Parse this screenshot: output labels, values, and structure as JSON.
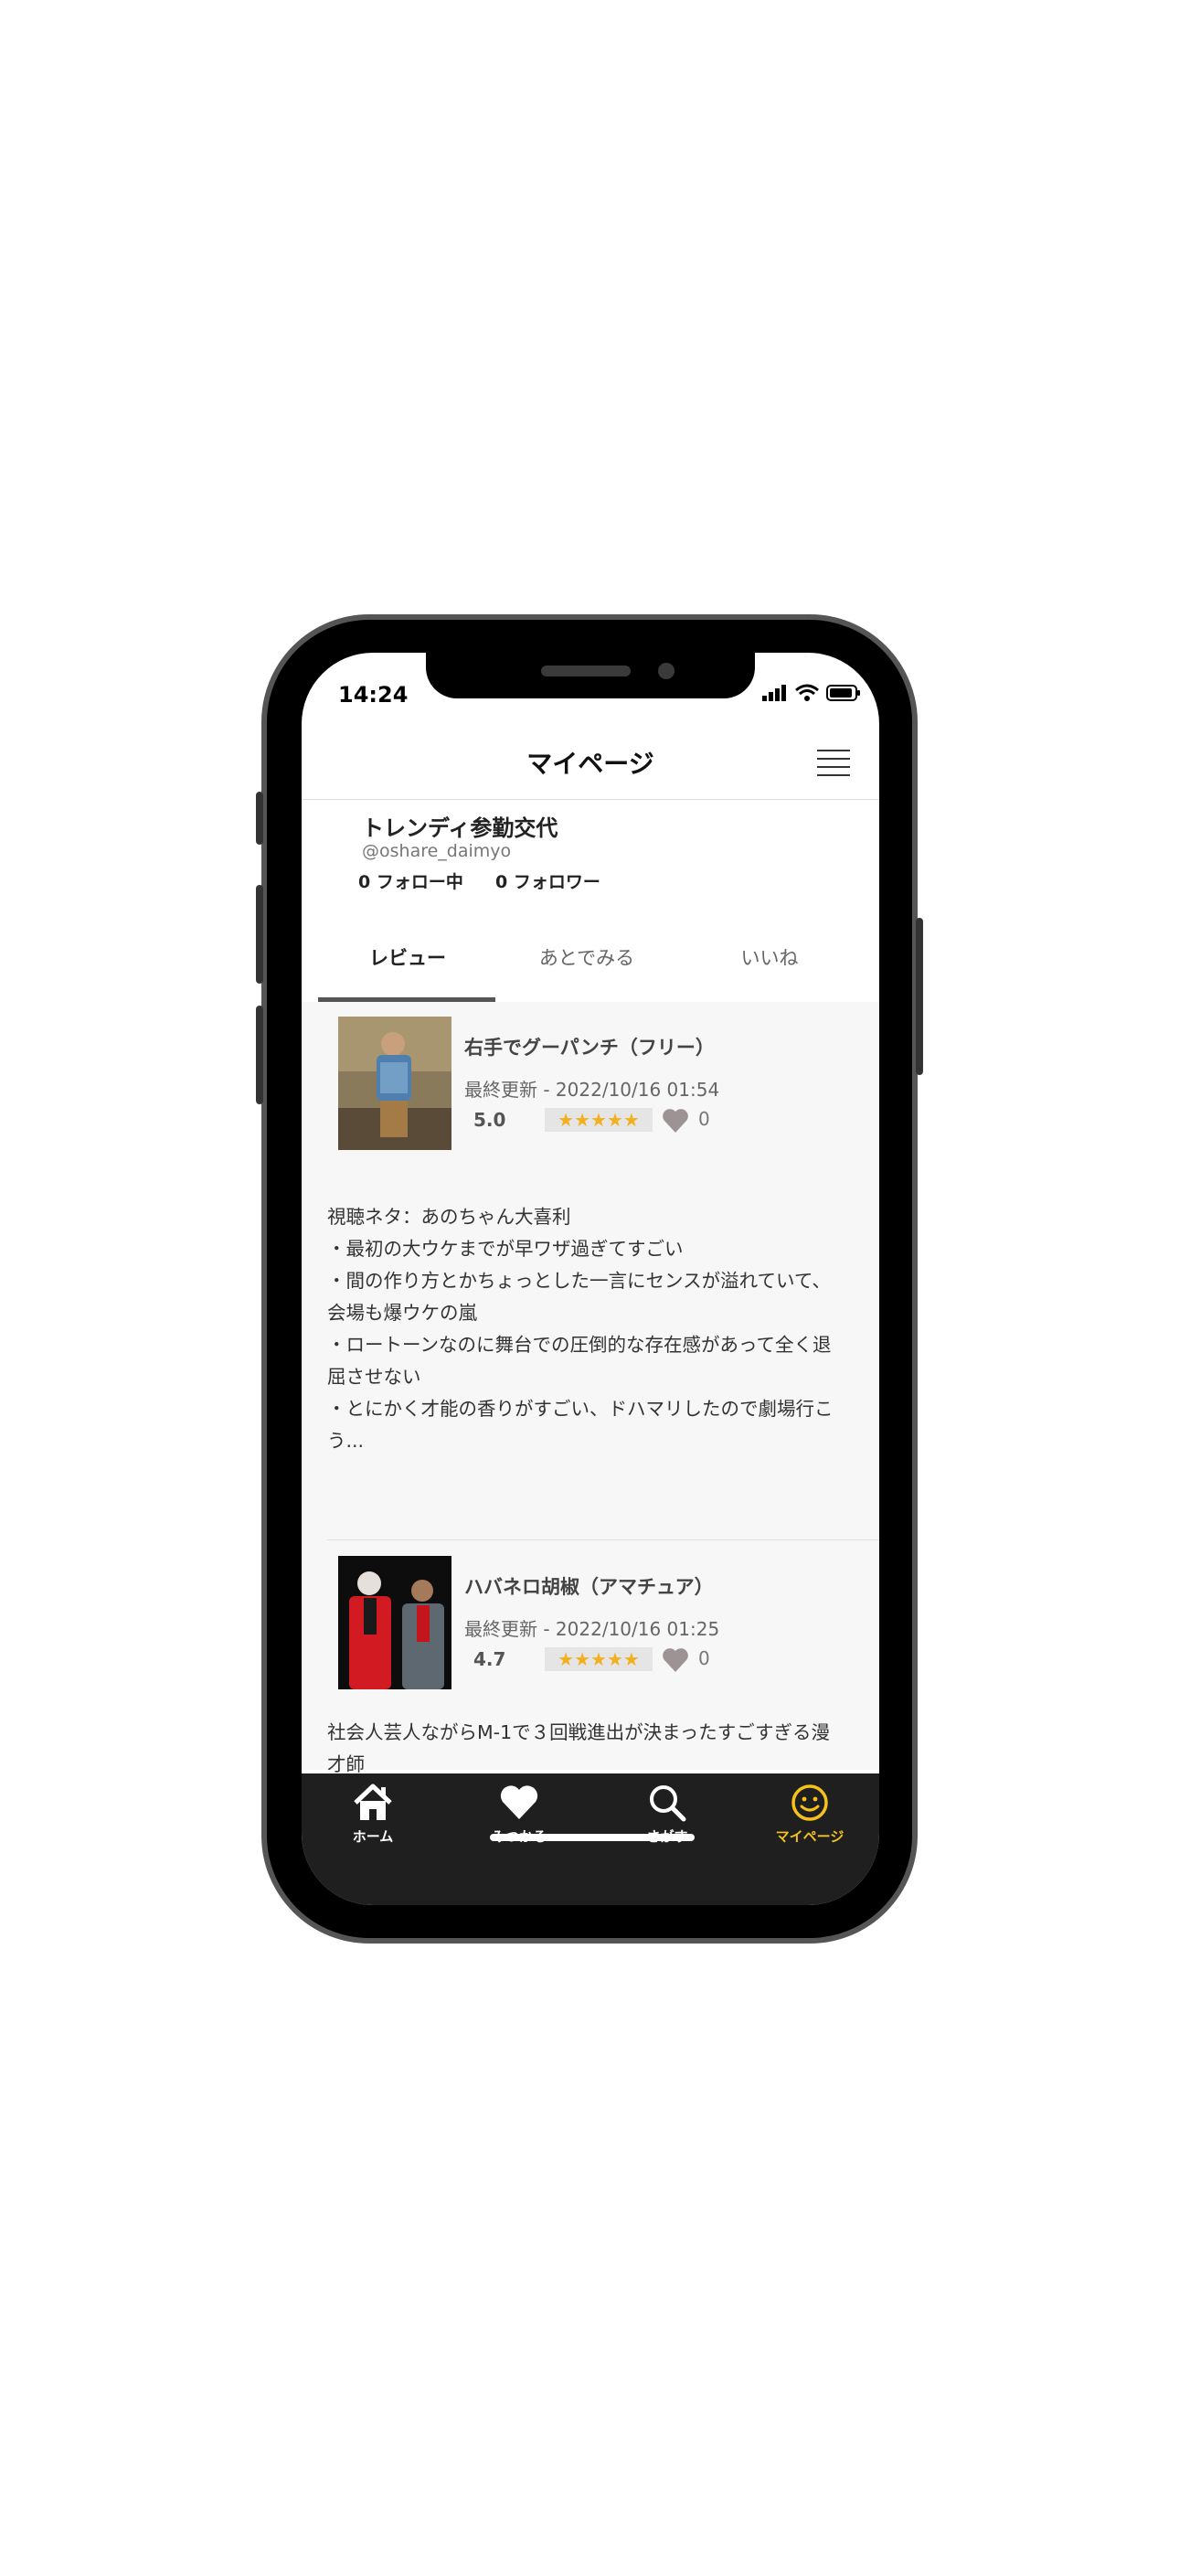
{
  "status_bar": {
    "time": "14:24"
  },
  "nav": {
    "title": "マイページ"
  },
  "profile": {
    "name": "トレンディ参勤交代",
    "handle": "@oshare_daimyo",
    "following": "0 フォロー中",
    "followers": "0 フォロワー"
  },
  "tabs": [
    {
      "label": "レビュー",
      "active": true
    },
    {
      "label": "あとでみる",
      "active": false
    },
    {
      "label": "いいね",
      "active": false
    }
  ],
  "reviews": [
    {
      "title": "右手でグーパンチ（フリー）",
      "date": "最終更新 - 2022/10/16 01:54",
      "score": "5.0",
      "rating": 5.0,
      "stars": "★★★★★",
      "likes": "0",
      "body": "視聴ネタ：あのちゃん大喜利\n・最初の大ウケまでが早ワザ過ぎてすごい\n・間の作り方とかちょっとした一言にセンスが溢れていて、会場も爆ウケの嵐\n・ロートーンなのに舞台での圧倒的な存在感があって全く退屈させない\n・とにかく才能の香りがすごい、ドハマリしたので劇場行こう..."
    },
    {
      "title": "ハバネロ胡椒（アマチュア）",
      "date": "最終更新 - 2022/10/16 01:25",
      "score": "4.7",
      "rating": 4.7,
      "stars": "★★★★★",
      "likes": "0",
      "body": "社会人芸人ながらM-1で３回戦進出が決まったすごすぎる漫才師"
    }
  ],
  "tabbar": [
    {
      "label": "ホーム",
      "icon": "home-icon",
      "active": false
    },
    {
      "label": "みつかる",
      "icon": "heart-icon",
      "active": false
    },
    {
      "label": "さがす",
      "icon": "search-icon",
      "active": false
    },
    {
      "label": "マイページ",
      "icon": "smiley-icon",
      "active": true
    }
  ],
  "colors": {
    "accent": "#f5c21b",
    "tabbar_bg": "#1f1f1f",
    "star": "#f2b01e"
  }
}
